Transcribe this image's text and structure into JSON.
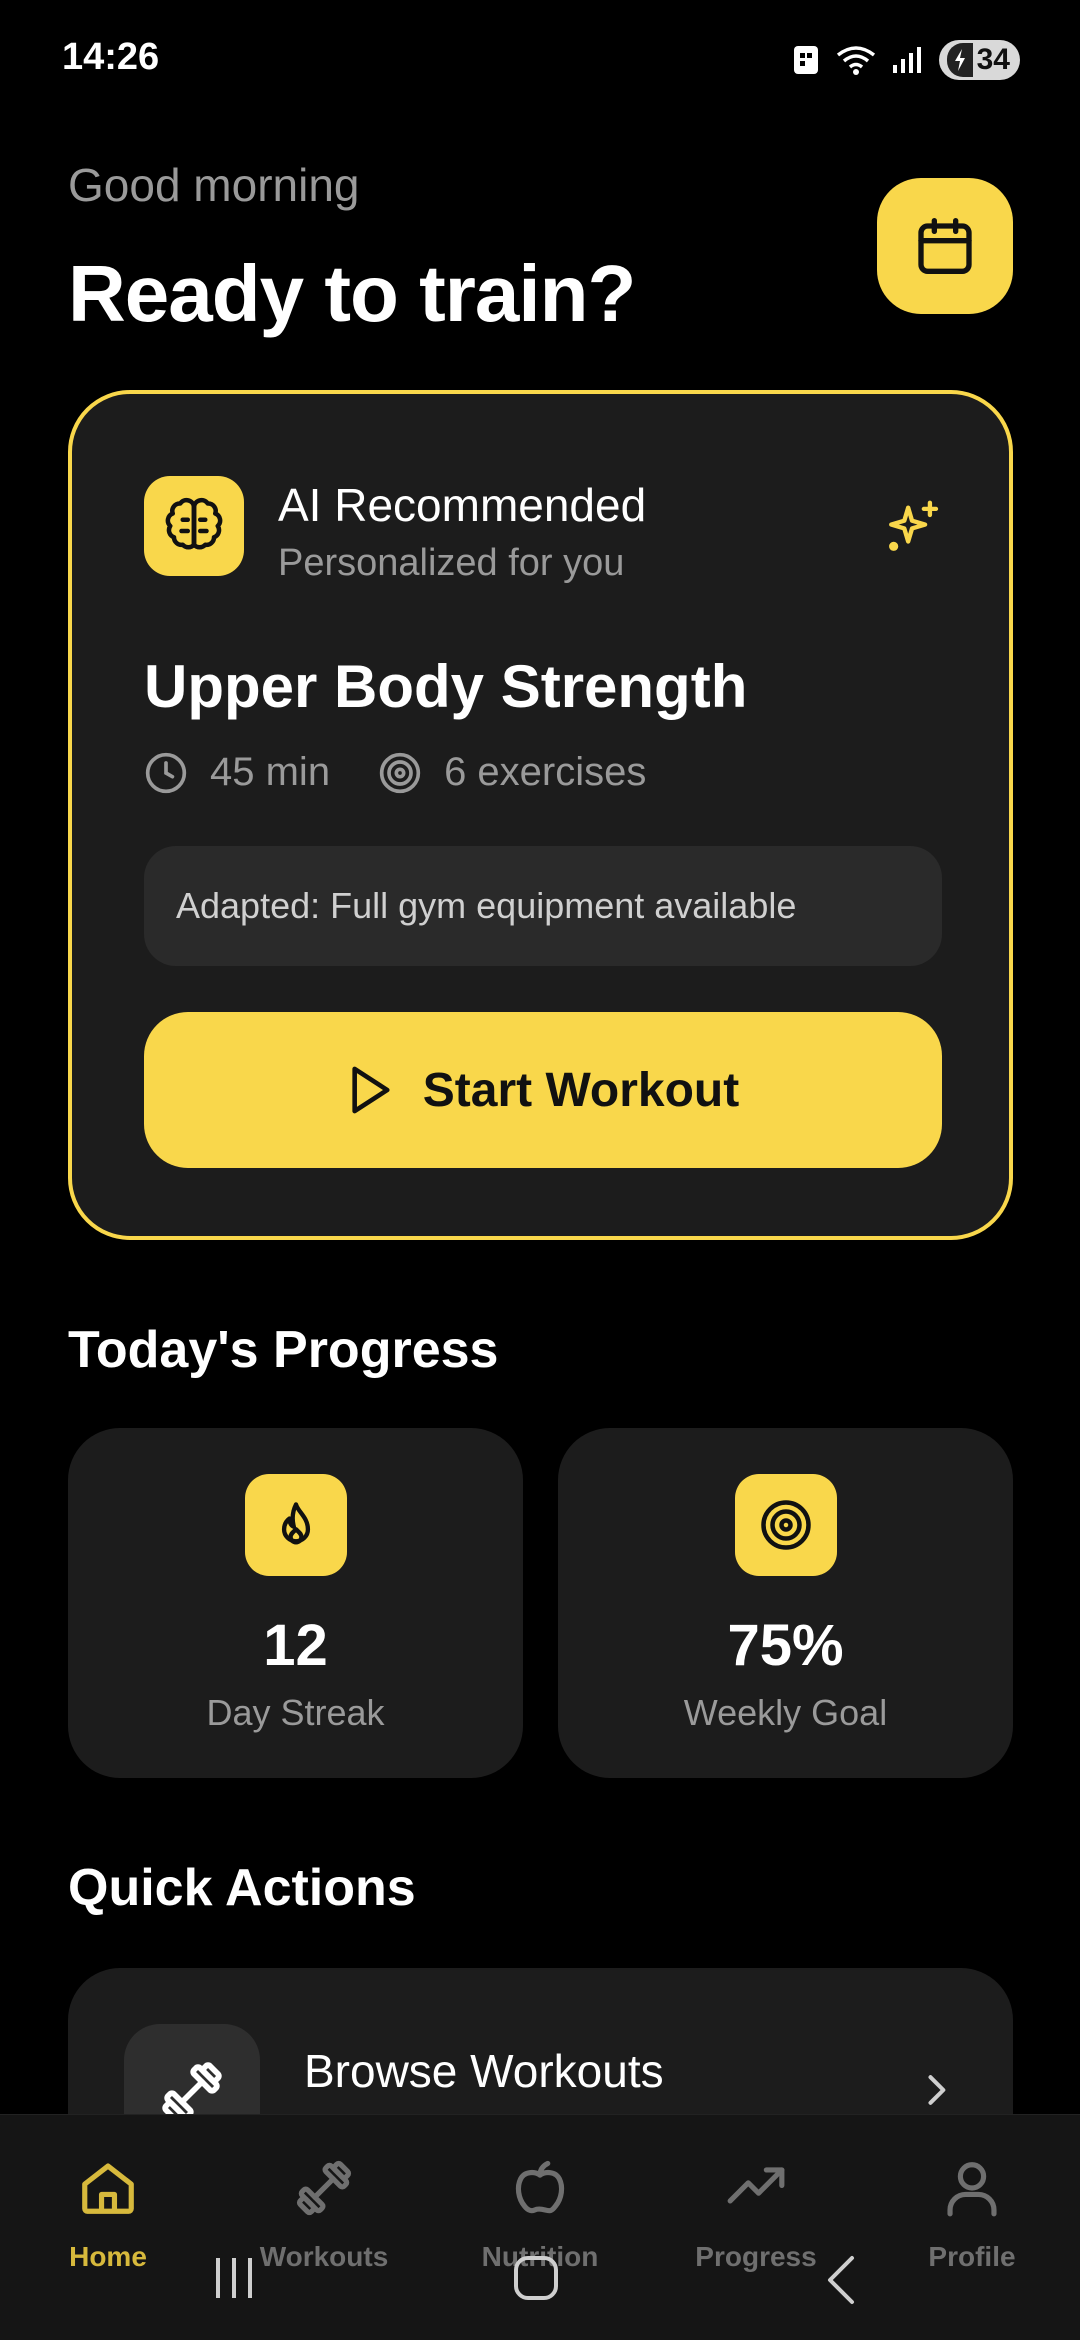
{
  "status_bar": {
    "time": "14:26",
    "battery": "34"
  },
  "header": {
    "greeting": "Good morning",
    "headline": "Ready to train?"
  },
  "ai_card": {
    "title": "AI Recommended",
    "subtitle": "Personalized for you",
    "workout_name": "Upper Body Strength",
    "duration": "45 min",
    "exercises": "6 exercises",
    "adapted_note": "Adapted: Full gym equipment available",
    "start_label": "Start Workout"
  },
  "progress": {
    "section_title": "Today's Progress",
    "streak_value": "12",
    "streak_label": "Day Streak",
    "goal_value": "75%",
    "goal_label": "Weekly Goal"
  },
  "quick_actions": {
    "section_title": "Quick Actions",
    "items": [
      {
        "label": "Browse Workouts"
      }
    ]
  },
  "bottom_nav": {
    "items": [
      {
        "label": "Home",
        "icon": "home-icon",
        "active": true
      },
      {
        "label": "Workouts",
        "icon": "dumbbell-icon",
        "active": false
      },
      {
        "label": "Nutrition",
        "icon": "apple-icon",
        "active": false
      },
      {
        "label": "Progress",
        "icon": "trending-up-icon",
        "active": false
      },
      {
        "label": "Profile",
        "icon": "user-icon",
        "active": false
      }
    ]
  },
  "colors": {
    "accent": "#f9d74b",
    "card": "#1c1c1c",
    "background": "#000000",
    "muted_text": "#9a9a9a"
  }
}
